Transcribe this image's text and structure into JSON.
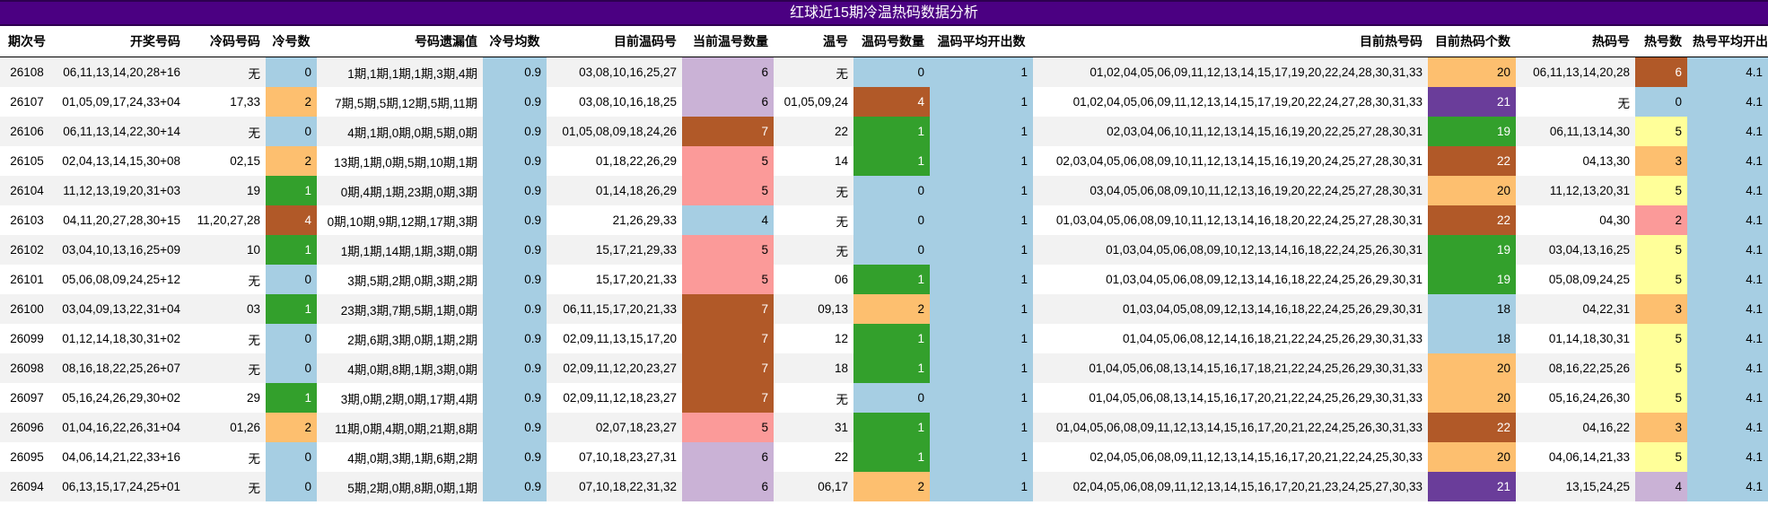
{
  "title": "红球近15期冷温热码数据分析",
  "headers": [
    "期次号",
    "开奖号码",
    "冷码号码",
    "冷号数",
    "号码遗漏值",
    "冷号均数",
    "目前温码号",
    "当前温号数量",
    "温号",
    "温码号数量",
    "温码平均开出数",
    "目前热号码",
    "目前热码个数",
    "热码号",
    "热号数",
    "热号平均开出数"
  ],
  "colors": {
    "blue": "#a6cee3",
    "green": "#33a02c",
    "orange": "#fdbf6f",
    "rust": "#b15928",
    "purple": "#6a3d9a",
    "lavender": "#cab2d6",
    "pink": "#fb9a99",
    "yellow": "#ffff99"
  },
  "rows": [
    {
      "issue": "26108",
      "draw": "06,11,13,14,20,28+16",
      "cold": "无",
      "cold_n": "0",
      "cold_n_color": "blue",
      "omit": "1期,1期,1期,1期,3期,4期",
      "cold_avg": "0.9",
      "warm": "03,08,10,16,25,27",
      "warm_cnt": "6",
      "warm_cnt_color": "lavender",
      "warm_hit": "无",
      "warm_hit_n": "0",
      "warm_hit_n_color": "blue",
      "warm_avg": "1",
      "hot": "01,02,04,05,06,09,11,12,13,14,15,17,19,20,22,24,28,30,31,33",
      "hot_cnt": "20",
      "hot_cnt_color": "orange",
      "hot_hit": "06,11,13,14,20,28",
      "hot_hit_n": "6",
      "hot_hit_n_color": "rust",
      "hot_avg": "4.1"
    },
    {
      "issue": "26107",
      "draw": "01,05,09,17,24,33+04",
      "cold": "17,33",
      "cold_n": "2",
      "cold_n_color": "orange",
      "omit": "7期,5期,5期,12期,5期,11期",
      "cold_avg": "0.9",
      "warm": "03,08,10,16,18,25",
      "warm_cnt": "6",
      "warm_cnt_color": "lavender",
      "warm_hit": "01,05,09,24",
      "warm_hit_n": "4",
      "warm_hit_n_color": "rust",
      "warm_avg": "1",
      "hot": "01,02,04,05,06,09,11,12,13,14,15,17,19,20,22,24,27,28,30,31,33",
      "hot_cnt": "21",
      "hot_cnt_color": "purple",
      "hot_hit": "无",
      "hot_hit_n": "0",
      "hot_hit_n_color": "blue",
      "hot_avg": "4.1"
    },
    {
      "issue": "26106",
      "draw": "06,11,13,14,22,30+14",
      "cold": "无",
      "cold_n": "0",
      "cold_n_color": "blue",
      "omit": "4期,1期,0期,0期,5期,0期",
      "cold_avg": "0.9",
      "warm": "01,05,08,09,18,24,26",
      "warm_cnt": "7",
      "warm_cnt_color": "rust",
      "warm_hit": "22",
      "warm_hit_n": "1",
      "warm_hit_n_color": "green",
      "warm_avg": "1",
      "hot": "02,03,04,06,10,11,12,13,14,15,16,19,20,22,25,27,28,30,31",
      "hot_cnt": "19",
      "hot_cnt_color": "green",
      "hot_hit": "06,11,13,14,30",
      "hot_hit_n": "5",
      "hot_hit_n_color": "yellow",
      "hot_avg": "4.1"
    },
    {
      "issue": "26105",
      "draw": "02,04,13,14,15,30+08",
      "cold": "02,15",
      "cold_n": "2",
      "cold_n_color": "orange",
      "omit": "13期,1期,0期,5期,10期,1期",
      "cold_avg": "0.9",
      "warm": "01,18,22,26,29",
      "warm_cnt": "5",
      "warm_cnt_color": "pink",
      "warm_hit": "14",
      "warm_hit_n": "1",
      "warm_hit_n_color": "green",
      "warm_avg": "1",
      "hot": "02,03,04,05,06,08,09,10,11,12,13,14,15,16,19,20,24,25,27,28,30,31",
      "hot_cnt": "22",
      "hot_cnt_color": "rust",
      "hot_hit": "04,13,30",
      "hot_hit_n": "3",
      "hot_hit_n_color": "orange",
      "hot_avg": "4.1"
    },
    {
      "issue": "26104",
      "draw": "11,12,13,19,20,31+03",
      "cold": "19",
      "cold_n": "1",
      "cold_n_color": "green",
      "omit": "0期,4期,1期,23期,0期,3期",
      "cold_avg": "0.9",
      "warm": "01,14,18,26,29",
      "warm_cnt": "5",
      "warm_cnt_color": "pink",
      "warm_hit": "无",
      "warm_hit_n": "0",
      "warm_hit_n_color": "blue",
      "warm_avg": "1",
      "hot": "03,04,05,06,08,09,10,11,12,13,16,19,20,22,24,25,27,28,30,31",
      "hot_cnt": "20",
      "hot_cnt_color": "orange",
      "hot_hit": "11,12,13,20,31",
      "hot_hit_n": "5",
      "hot_hit_n_color": "yellow",
      "hot_avg": "4.1"
    },
    {
      "issue": "26103",
      "draw": "04,11,20,27,28,30+15",
      "cold": "11,20,27,28",
      "cold_n": "4",
      "cold_n_color": "rust",
      "omit": "0期,10期,9期,12期,17期,3期",
      "cold_avg": "0.9",
      "warm": "21,26,29,33",
      "warm_cnt": "4",
      "warm_cnt_color": "blue",
      "warm_hit": "无",
      "warm_hit_n": "0",
      "warm_hit_n_color": "blue",
      "warm_avg": "1",
      "hot": "01,03,04,05,06,08,09,10,11,12,13,14,16,18,20,22,24,25,27,28,30,31",
      "hot_cnt": "22",
      "hot_cnt_color": "rust",
      "hot_hit": "04,30",
      "hot_hit_n": "2",
      "hot_hit_n_color": "pink",
      "hot_avg": "4.1"
    },
    {
      "issue": "26102",
      "draw": "03,04,10,13,16,25+09",
      "cold": "10",
      "cold_n": "1",
      "cold_n_color": "green",
      "omit": "1期,1期,14期,1期,3期,0期",
      "cold_avg": "0.9",
      "warm": "15,17,21,29,33",
      "warm_cnt": "5",
      "warm_cnt_color": "pink",
      "warm_hit": "无",
      "warm_hit_n": "0",
      "warm_hit_n_color": "blue",
      "warm_avg": "1",
      "hot": "01,03,04,05,06,08,09,10,12,13,14,16,18,22,24,25,26,30,31",
      "hot_cnt": "19",
      "hot_cnt_color": "green",
      "hot_hit": "03,04,13,16,25",
      "hot_hit_n": "5",
      "hot_hit_n_color": "yellow",
      "hot_avg": "4.1"
    },
    {
      "issue": "26101",
      "draw": "05,06,08,09,24,25+12",
      "cold": "无",
      "cold_n": "0",
      "cold_n_color": "blue",
      "omit": "3期,5期,2期,0期,3期,2期",
      "cold_avg": "0.9",
      "warm": "15,17,20,21,33",
      "warm_cnt": "5",
      "warm_cnt_color": "pink",
      "warm_hit": "06",
      "warm_hit_n": "1",
      "warm_hit_n_color": "green",
      "warm_avg": "1",
      "hot": "01,03,04,05,06,08,09,12,13,14,16,18,22,24,25,26,29,30,31",
      "hot_cnt": "19",
      "hot_cnt_color": "green",
      "hot_hit": "05,08,09,24,25",
      "hot_hit_n": "5",
      "hot_hit_n_color": "yellow",
      "hot_avg": "4.1"
    },
    {
      "issue": "26100",
      "draw": "03,04,09,13,22,31+04",
      "cold": "03",
      "cold_n": "1",
      "cold_n_color": "green",
      "omit": "23期,3期,7期,5期,1期,0期",
      "cold_avg": "0.9",
      "warm": "06,11,15,17,20,21,33",
      "warm_cnt": "7",
      "warm_cnt_color": "rust",
      "warm_hit": "09,13",
      "warm_hit_n": "2",
      "warm_hit_n_color": "orange",
      "warm_avg": "1",
      "hot": "01,03,04,05,08,09,12,13,14,16,18,22,24,25,26,29,30,31",
      "hot_cnt": "18",
      "hot_cnt_color": "blue",
      "hot_hit": "04,22,31",
      "hot_hit_n": "3",
      "hot_hit_n_color": "orange",
      "hot_avg": "4.1"
    },
    {
      "issue": "26099",
      "draw": "01,12,14,18,30,31+02",
      "cold": "无",
      "cold_n": "0",
      "cold_n_color": "blue",
      "omit": "2期,6期,3期,0期,1期,2期",
      "cold_avg": "0.9",
      "warm": "02,09,11,13,15,17,20",
      "warm_cnt": "7",
      "warm_cnt_color": "rust",
      "warm_hit": "12",
      "warm_hit_n": "1",
      "warm_hit_n_color": "green",
      "warm_avg": "1",
      "hot": "01,04,05,06,08,12,14,16,18,21,22,24,25,26,29,30,31,33",
      "hot_cnt": "18",
      "hot_cnt_color": "blue",
      "hot_hit": "01,14,18,30,31",
      "hot_hit_n": "5",
      "hot_hit_n_color": "yellow",
      "hot_avg": "4.1"
    },
    {
      "issue": "26098",
      "draw": "08,16,18,22,25,26+07",
      "cold": "无",
      "cold_n": "0",
      "cold_n_color": "blue",
      "omit": "4期,0期,8期,1期,3期,0期",
      "cold_avg": "0.9",
      "warm": "02,09,11,12,20,23,27",
      "warm_cnt": "7",
      "warm_cnt_color": "rust",
      "warm_hit": "18",
      "warm_hit_n": "1",
      "warm_hit_n_color": "green",
      "warm_avg": "1",
      "hot": "01,04,05,06,08,13,14,15,16,17,18,21,22,24,25,26,29,30,31,33",
      "hot_cnt": "20",
      "hot_cnt_color": "orange",
      "hot_hit": "08,16,22,25,26",
      "hot_hit_n": "5",
      "hot_hit_n_color": "yellow",
      "hot_avg": "4.1"
    },
    {
      "issue": "26097",
      "draw": "05,16,24,26,29,30+02",
      "cold": "29",
      "cold_n": "1",
      "cold_n_color": "green",
      "omit": "3期,0期,2期,0期,17期,4期",
      "cold_avg": "0.9",
      "warm": "02,09,11,12,18,23,27",
      "warm_cnt": "7",
      "warm_cnt_color": "rust",
      "warm_hit": "无",
      "warm_hit_n": "0",
      "warm_hit_n_color": "blue",
      "warm_avg": "1",
      "hot": "01,04,05,06,08,13,14,15,16,17,20,21,22,24,25,26,29,30,31,33",
      "hot_cnt": "20",
      "hot_cnt_color": "orange",
      "hot_hit": "05,16,24,26,30",
      "hot_hit_n": "5",
      "hot_hit_n_color": "yellow",
      "hot_avg": "4.1"
    },
    {
      "issue": "26096",
      "draw": "01,04,16,22,26,31+04",
      "cold": "01,26",
      "cold_n": "2",
      "cold_n_color": "orange",
      "omit": "11期,0期,4期,0期,21期,8期",
      "cold_avg": "0.9",
      "warm": "02,07,18,23,27",
      "warm_cnt": "5",
      "warm_cnt_color": "pink",
      "warm_hit": "31",
      "warm_hit_n": "1",
      "warm_hit_n_color": "green",
      "warm_avg": "1",
      "hot": "01,04,05,06,08,09,11,12,13,14,15,16,17,20,21,22,24,25,26,30,31,33",
      "hot_cnt": "22",
      "hot_cnt_color": "rust",
      "hot_hit": "04,16,22",
      "hot_hit_n": "3",
      "hot_hit_n_color": "orange",
      "hot_avg": "4.1"
    },
    {
      "issue": "26095",
      "draw": "04,06,14,21,22,33+16",
      "cold": "无",
      "cold_n": "0",
      "cold_n_color": "blue",
      "omit": "4期,0期,3期,1期,6期,2期",
      "cold_avg": "0.9",
      "warm": "07,10,18,23,27,31",
      "warm_cnt": "6",
      "warm_cnt_color": "lavender",
      "warm_hit": "22",
      "warm_hit_n": "1",
      "warm_hit_n_color": "green",
      "warm_avg": "1",
      "hot": "02,04,05,06,08,09,11,12,13,14,15,16,17,20,21,22,24,25,30,33",
      "hot_cnt": "20",
      "hot_cnt_color": "orange",
      "hot_hit": "04,06,14,21,33",
      "hot_hit_n": "5",
      "hot_hit_n_color": "yellow",
      "hot_avg": "4.1"
    },
    {
      "issue": "26094",
      "draw": "06,13,15,17,24,25+01",
      "cold": "无",
      "cold_n": "0",
      "cold_n_color": "blue",
      "omit": "5期,2期,0期,8期,0期,1期",
      "cold_avg": "0.9",
      "warm": "07,10,18,22,31,32",
      "warm_cnt": "6",
      "warm_cnt_color": "lavender",
      "warm_hit": "06,17",
      "warm_hit_n": "2",
      "warm_hit_n_color": "orange",
      "warm_avg": "1",
      "hot": "02,04,05,06,08,09,11,12,13,14,15,16,17,20,21,23,24,25,27,30,33",
      "hot_cnt": "21",
      "hot_cnt_color": "purple",
      "hot_hit": "13,15,24,25",
      "hot_hit_n": "4",
      "hot_hit_n_color": "lavender",
      "hot_avg": "4.1"
    }
  ]
}
